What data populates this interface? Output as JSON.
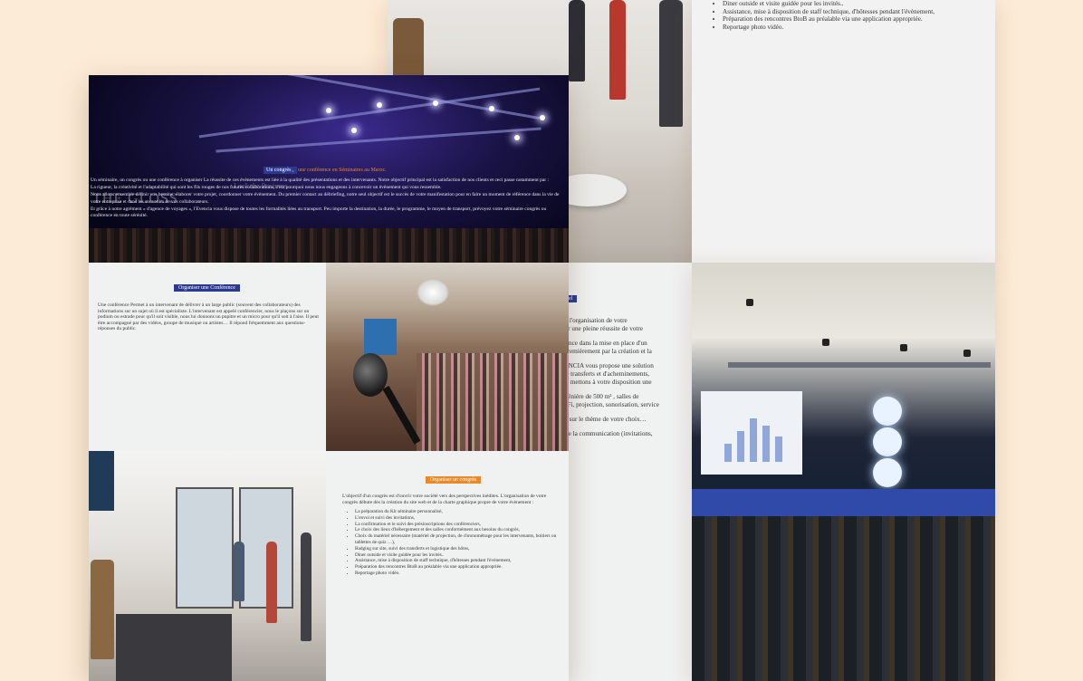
{
  "colors": {
    "background": "#fcebd6",
    "badge_blue": "#2b3a8f",
    "badge_orange": "#e98a2a",
    "panel_grey": "#f0f1f1"
  },
  "hero": {
    "tag_main": "Un congrès ,",
    "tag_accent": "une conférence en Séminaires au Maroc.",
    "watermark": "THE GLOSS",
    "watermark_small": "Look the Business",
    "paragraphs": [
      "Un séminaire, un congrès ou une conférence à organiser La réussite de ces évènements est liée à la qualité des présentations et des intervenants. Notre objectif principal est la satisfaction de nos clients et ceci passe notamment par :",
      "La rigueur, la créativité et l'adaptabilité qui sont les fils rouges de nos futures collaborations, c'est pourquoi nous nous engageons à concevoir un évènement qui vous ressemble.",
      "Nous allons ensemble définir vos besoins, élaborer votre projet, coordonner votre évènement. Du premier contact au débriefing, notre seul objectif est le succès de votre manifestation pour en faire un moment de référence dans la vie de votre entreprise et dans les souvenirs de vos collaborateurs.",
      "Et grâce à notre agrément « d'agence de voyages », l'Evencia vous dispose de toutes les formalités liées au transport. Peu importe la destination, la durée, le programme, le moyen de transport, prévoyez votre séminaire congrès ou conférence en toute sérénité."
    ]
  },
  "conference": {
    "title": "Organiser une Conférence",
    "text": "Une conférence Permet à un intervenant de délivrer à un large public (souvent des collaborateurs) des informations sur un sujet où il est spécialiste. L'intervenant est appelé conférencier, nous le plaçons sur un podium ou estrade pour qu'il soit visible, nous lui donnons un pupitre et un micro pour qu'il soit à l'aise. Il peut être accompagné par des vidéos, groupe de musique ou artistes… Il répond fréquemment aux questions-réponses du public."
  },
  "congres": {
    "title": "Organiser un congrès",
    "intro": "L'objectif d'un congrès est d'ouvrir votre société vers des perspectives inédites. L'organisation de votre congrès débute dès la création du site web et de la charte graphique propre de votre évènement :",
    "items": [
      "La préparation du Kit séminaire personnalisé,",
      "L'envoi et suivi des invitations,",
      "La confirmation et le suivi des présinscriptions des conférenciers,",
      "Le choix des lieux d'hébergement et des salles conformément aux besoins du congrès,",
      "Choix du matériel nécessaire (matériel de projection, de chronométrage pour les intervenants, boitiers ou tablettes de quiz …),",
      "Badging sur site, suivi des transferts et logistique des hôtes,",
      "Diner outside et visite guidée pour les invités..",
      "Assistance, mise à disposition de staff technique, d'hôtesses pendant l'évènement,",
      "Préparation des rencontres BtoB au préalable via une application appropriée.",
      "Reportage photo vidéo."
    ]
  },
  "back_top": {
    "items": [
      "Diner outside et visite guidée pour les invités..",
      "Assistance, mise à disposition de staff technique, d'hôtesses pendant l'évènement,",
      "Préparation des rencontres BtoB au préalable via une application appropriée.",
      "Reportage photo vidéo."
    ]
  },
  "back_mid": {
    "title": "onnel",
    "lines": [
      "rge l'organisation de votre",
      "urer une pleine réussite de votre",
      "agence dans la mise en place d'un",
      "e premièrement par la création et la",
      "VENCIA vous propose une solution",
      ", de transferts et d'acheminements,",
      "ous mettons à votre disposition une",
      ", plénière de 500 m² , salles de",
      "WiFi, projection, sonorisation, service",
      "rée sur le thème de votre choix…",
      "), de la communication (invitations,"
    ]
  }
}
